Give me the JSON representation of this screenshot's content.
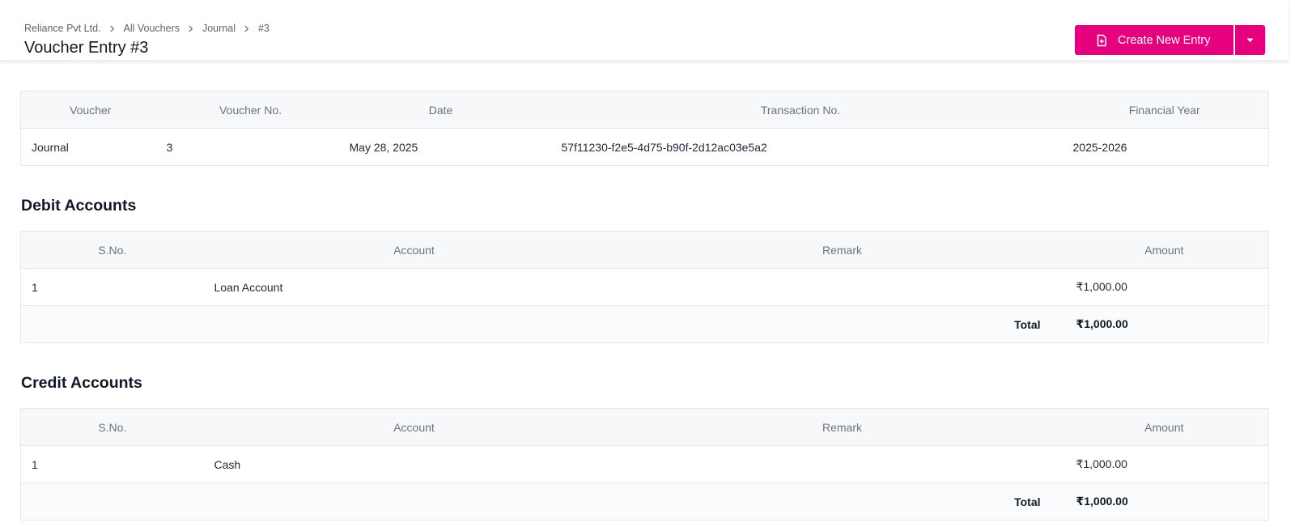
{
  "breadcrumb": {
    "items": [
      "Reliance Pvt Ltd.",
      "All Vouchers",
      "Journal",
      "#3"
    ]
  },
  "header": {
    "title": "Voucher Entry #3",
    "create_label": "Create New Entry"
  },
  "voucher": {
    "columns": [
      "Voucher",
      "Voucher No.",
      "Date",
      "Transaction No.",
      "Financial Year"
    ],
    "row": [
      "Journal",
      "3",
      "May 28, 2025",
      "57f11230-f2e5-4d75-b90f-2d12ac03e5a2",
      "2025-2026"
    ]
  },
  "debit": {
    "title": "Debit Accounts",
    "columns": [
      "S.No.",
      "Account",
      "Remark",
      "Amount"
    ],
    "rows": [
      {
        "sno": "1",
        "account": "Loan Account",
        "remark": "",
        "amount": "₹1,000.00"
      }
    ],
    "total_label": "Total",
    "total_value": "₹1,000.00"
  },
  "credit": {
    "title": "Credit Accounts",
    "columns": [
      "S.No.",
      "Account",
      "Remark",
      "Amount"
    ],
    "rows": [
      {
        "sno": "1",
        "account": "Cash",
        "remark": "",
        "amount": "₹1,000.00"
      }
    ],
    "total_label": "Total",
    "total_value": "₹1,000.00"
  },
  "colors": {
    "accent": "#e6007e",
    "header_bg": "#f7f8fa"
  },
  "icons": {
    "create": "file-plus-icon",
    "dropdown": "caret-down-icon",
    "separator": "chevron-right-icon"
  }
}
